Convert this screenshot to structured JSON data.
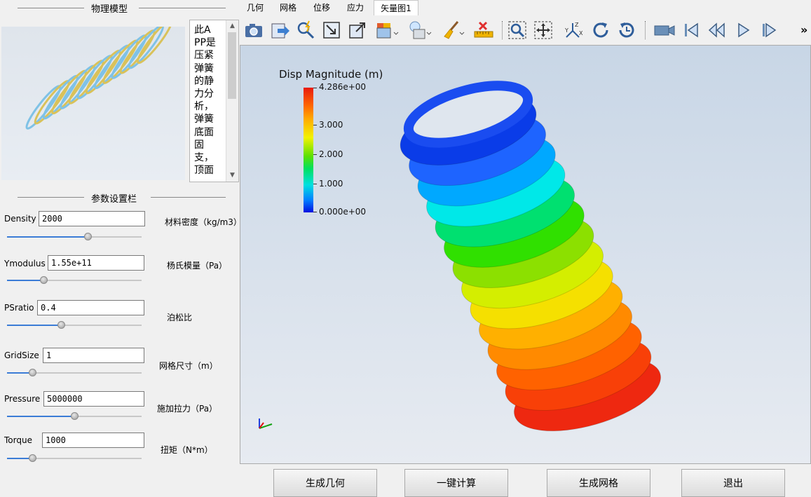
{
  "left_panel": {
    "model_header": "物理模型",
    "description": "此APP是压紧弹簧的静力分析，弹簧底面固支，顶面",
    "params_header": "参数设置栏",
    "params": [
      {
        "label": "Density",
        "value": "2000",
        "desc": "材料密度（kg/m3）",
        "slider": 0.6
      },
      {
        "label": "Ymodulus",
        "value": "1.55e+11",
        "desc": "杨氏模量（Pa）",
        "slider": 0.27
      },
      {
        "label": "PSratio",
        "value": "0.4",
        "desc": "泊松比",
        "slider": 0.4
      },
      {
        "label": "GridSize",
        "value": "1",
        "desc": "网格尺寸（m）",
        "slider": 0.19
      },
      {
        "label": "Pressure",
        "value": "5000000",
        "desc": "施加拉力（Pa）",
        "slider": 0.5
      },
      {
        "label": "Torque",
        "value": "1000",
        "desc": "扭矩（N*m）",
        "slider": 0.19
      }
    ]
  },
  "tabs": [
    "几何",
    "网格",
    "位移",
    "应力",
    "矢量图1"
  ],
  "active_tab": "矢量图1",
  "toolbar": {
    "icons": [
      "camera-icon",
      "export-icon",
      "probe-icon",
      "zoom-box-icon",
      "box-select-icon",
      "shade-cube-icon",
      "light-icon",
      "brush-icon",
      "ruler-icon",
      "zoom-fit-icon",
      "pan-icon",
      "axes-icon",
      "rotate-cw-icon",
      "rotate-ccw-icon",
      "video-icon",
      "first-frame-icon",
      "prev-frame-icon",
      "play-icon",
      "last-frame-icon"
    ],
    "more": "»"
  },
  "viewport": {
    "colorbar_title": "Disp Magnitude (m)",
    "labels": [
      "4.286e+00",
      "3.000",
      "2.000",
      "1.000",
      "0.000e+00"
    ],
    "colors": [
      "#e81a0b",
      "#ff6a00",
      "#f2f200",
      "#5ce000",
      "#00e0e0",
      "#0080ff",
      "#0010e0"
    ],
    "max": 4.286,
    "min": 0.0
  },
  "buttons": [
    "生成几何",
    "一键计算",
    "生成网格",
    "退出"
  ]
}
